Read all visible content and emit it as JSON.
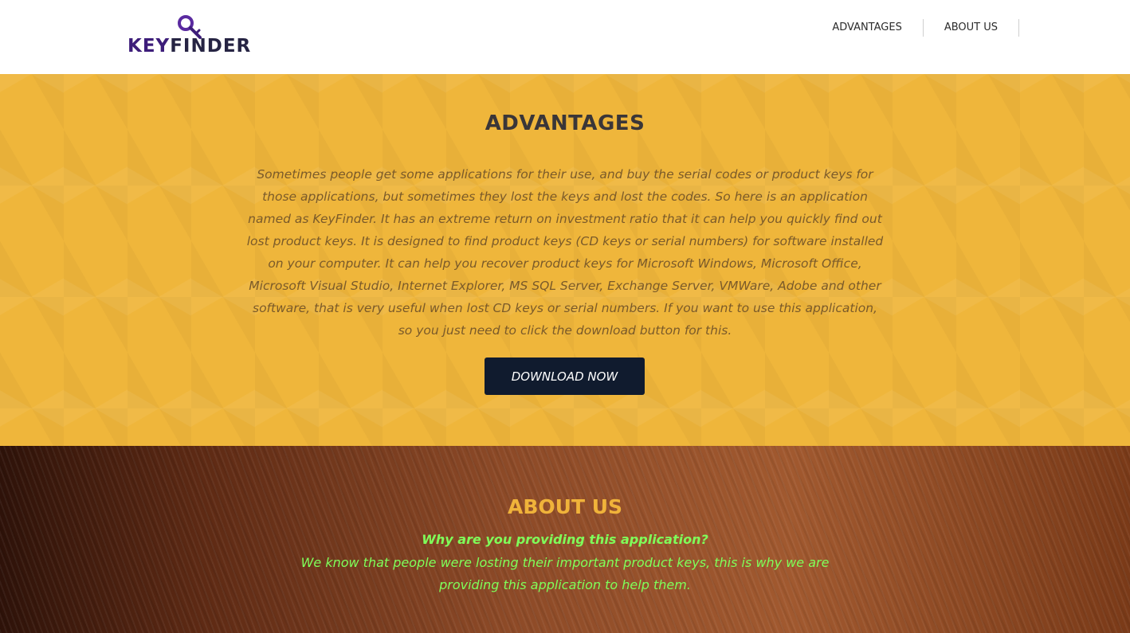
{
  "header": {
    "logo": {
      "text_part1": "KEY",
      "text_part2": "FINDER",
      "icon": "key-icon"
    },
    "nav": [
      {
        "label": "ADVANTAGES"
      },
      {
        "label": "ABOUT US"
      }
    ]
  },
  "advantages": {
    "title": "ADVANTAGES",
    "body": "Sometimes people get some applications for their use, and buy the serial codes or product keys for those applications, but sometimes they lost the keys and lost the codes. So here is an application named as KeyFinder. It has an extreme return on investment ratio that it can help you quickly find out lost product keys. It is designed to find product keys (CD keys or serial numbers) for software installed on your computer. It can help you recover product keys for Microsoft Windows, Microsoft Office, Microsoft Visual Studio, Internet Explorer, MS SQL Server, Exchange Server, VMWare, Adobe and other software, that is very useful when lost CD keys or serial numbers. If you want to use this application, so you just need to click the download button for this.",
    "download_label": "DOWNLOAD NOW"
  },
  "about": {
    "title": "ABOUT US",
    "question": "Why are you providing this application?",
    "answer": "We know that people were losting their important product keys, this is why we are providing this application to help them."
  },
  "colors": {
    "advantages_bg": "#efb63b",
    "button_bg": "#101b2e",
    "about_title": "#f0b33a",
    "about_text": "#7fff5a",
    "logo_purple": "#3d1d7a"
  }
}
